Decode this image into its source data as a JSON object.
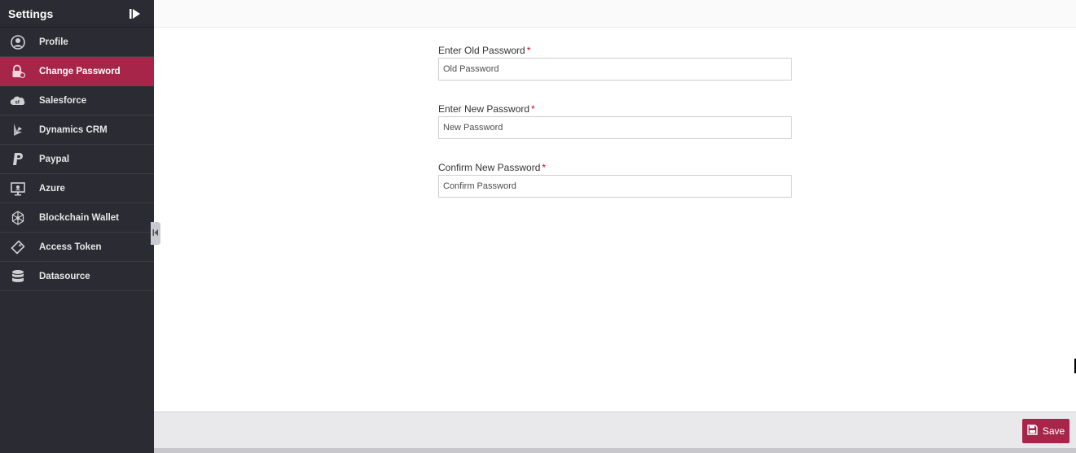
{
  "sidebar": {
    "title": "Settings",
    "items": [
      {
        "label": "Profile",
        "icon": "user-circle-icon",
        "active": false
      },
      {
        "label": "Change Password",
        "icon": "lock-icon",
        "active": true
      },
      {
        "label": "Salesforce",
        "icon": "salesforce-cloud-icon",
        "active": false
      },
      {
        "label": "Dynamics CRM",
        "icon": "dynamics-icon",
        "active": false
      },
      {
        "label": "Paypal",
        "icon": "paypal-icon",
        "active": false
      },
      {
        "label": "Azure",
        "icon": "monitor-icon",
        "active": false
      },
      {
        "label": "Blockchain Wallet",
        "icon": "blockchain-icon",
        "active": false
      },
      {
        "label": "Access Token",
        "icon": "tag-icon",
        "active": false
      },
      {
        "label": "Datasource",
        "icon": "database-icon",
        "active": false
      }
    ]
  },
  "form": {
    "old": {
      "label": "Enter Old Password",
      "required": "*",
      "placeholder": "Old Password",
      "value": ""
    },
    "new": {
      "label": "Enter New Password",
      "required": "*",
      "placeholder": "New Password",
      "value": ""
    },
    "confirm": {
      "label": "Confirm New Password",
      "required": "*",
      "placeholder": "Confirm Password",
      "value": ""
    }
  },
  "footer": {
    "save_label": "Save"
  },
  "colors": {
    "accent": "#a8254a",
    "sidebar_bg": "#2b2c33",
    "required": "#d0021b"
  }
}
